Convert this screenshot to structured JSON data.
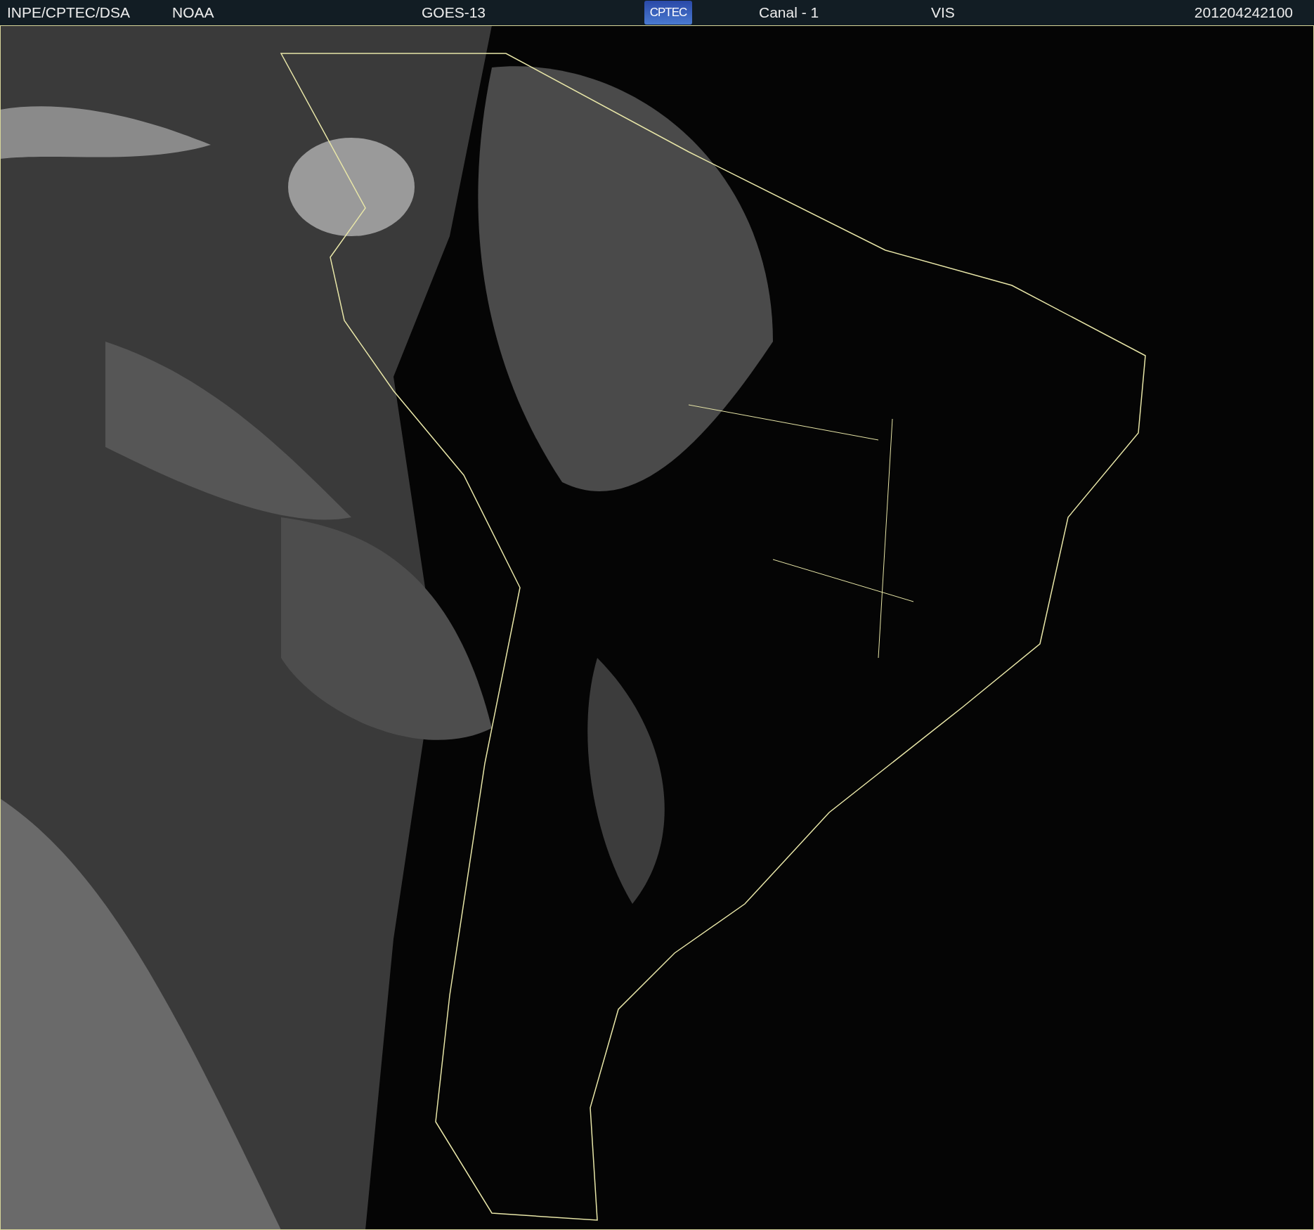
{
  "header": {
    "agency": "INPE/CPTEC/DSA",
    "provider": "NOAA",
    "satellite": "GOES-13",
    "logo": "CPTEC",
    "channel": "Canal - 1",
    "band": "VIS",
    "timestamp": "201204242100"
  }
}
